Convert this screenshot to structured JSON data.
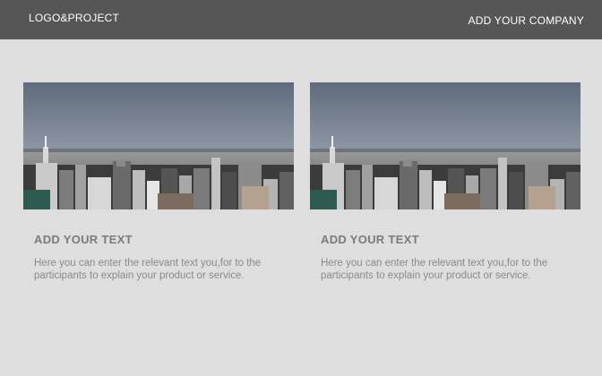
{
  "header": {
    "logo_text": "LOGO&PROJECT",
    "company_text": "ADD YOUR COMPANY"
  },
  "cards": [
    {
      "image_icon": "city-skyline-photo",
      "title": "ADD YOUR TEXT",
      "body": "Here you can enter the relevant text you,for to the participants to explain your product or service."
    },
    {
      "image_icon": "city-skyline-photo",
      "title": "ADD YOUR TEXT",
      "body": "Here you can enter the relevant text you,for to the participants to explain your product or service."
    }
  ],
  "colors": {
    "header_bg": "#565656",
    "page_bg": "#dedede",
    "title_text": "#7b7b7b",
    "body_text": "#8a8a8a"
  }
}
